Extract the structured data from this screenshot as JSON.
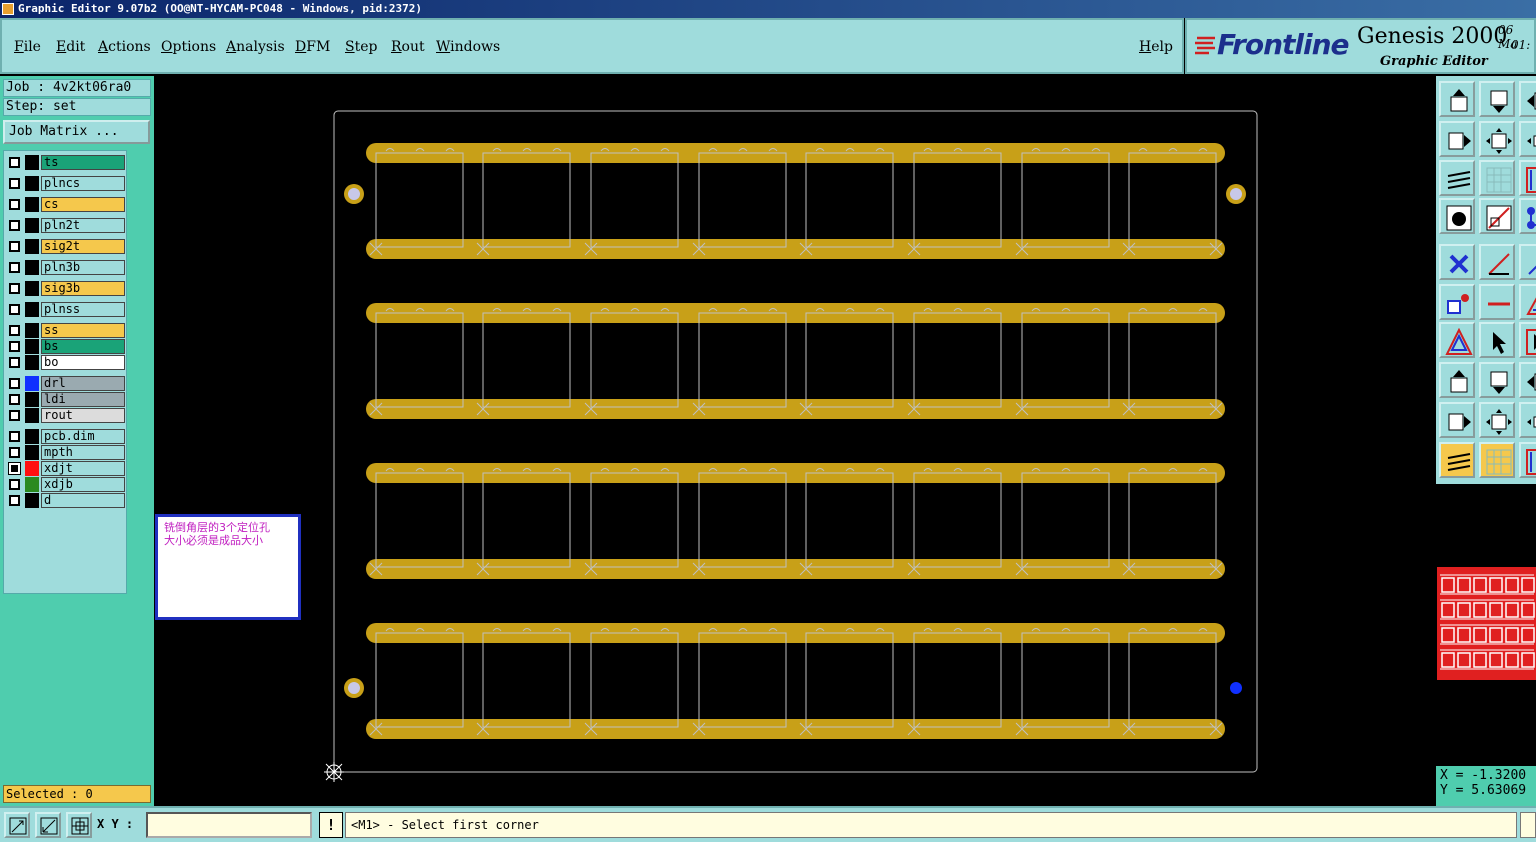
{
  "window": {
    "title": "Graphic Editor 9.07b2 (OO@NT-HYCAM-PC048 - Windows, pid:2372)"
  },
  "menu": {
    "file": "File",
    "edit": "Edit",
    "actions": "Actions",
    "options": "Options",
    "analysis": "Analysis",
    "dfm": "DFM",
    "step": "Step",
    "rout": "Rout",
    "windows": "Windows",
    "help": "Help"
  },
  "brand": {
    "logo": "Frontline",
    "product": "Genesis 2000",
    "subtitle": "Graphic Editor",
    "version_a": "06 Ma",
    "version_b": "01:"
  },
  "job": {
    "job_line": "Job : 4v2kt06ra0",
    "step_line": "Step: set",
    "matrix_button": "Job Matrix ..."
  },
  "layers": [
    {
      "name": "ts",
      "color": "#1aa378",
      "swatch": "#000000",
      "checked": false
    },
    {
      "name": "plncs",
      "color": "#9fdcdc",
      "swatch": "#000000",
      "checked": false
    },
    {
      "name": "cs",
      "color": "#f5c84c",
      "swatch": "#000000",
      "checked": false
    },
    {
      "name": "pln2t",
      "color": "#9fdcdc",
      "swatch": "#000000",
      "checked": false
    },
    {
      "name": "sig2t",
      "color": "#f5c84c",
      "swatch": "#000000",
      "checked": false
    },
    {
      "name": "pln3b",
      "color": "#9fdcdc",
      "swatch": "#000000",
      "checked": false
    },
    {
      "name": "sig3b",
      "color": "#f5c84c",
      "swatch": "#000000",
      "checked": false
    },
    {
      "name": "plnss",
      "color": "#9fdcdc",
      "swatch": "#000000",
      "checked": false
    },
    {
      "name": "ss",
      "color": "#f5c84c",
      "swatch": "#000000",
      "checked": false
    },
    {
      "name": "bs",
      "color": "#1aa378",
      "swatch": "#000000",
      "checked": false
    },
    {
      "name": "bo",
      "color": "#ffffff",
      "swatch": "#000000",
      "checked": false
    },
    {
      "name": "drl",
      "color": "#9aaab0",
      "swatch": "#1030ff",
      "checked": false
    },
    {
      "name": "ldi",
      "color": "#9aaab0",
      "swatch": "#000000",
      "checked": false
    },
    {
      "name": "rout",
      "color": "#dcdcdc",
      "swatch": "#000000",
      "checked": false
    },
    {
      "name": "pcb.dim",
      "color": "#9fdcdc",
      "swatch": "#000000",
      "checked": false
    },
    {
      "name": "mpth",
      "color": "#9fdcdc",
      "swatch": "#000000",
      "checked": false
    },
    {
      "name": "xdjt",
      "color": "#9fdcdc",
      "swatch": "#ff1010",
      "checked": true
    },
    {
      "name": "xdjb",
      "color": "#9fdcdc",
      "swatch": "#2a8a20",
      "checked": false
    },
    {
      "name": "d",
      "color": "#9fdcdc",
      "swatch": "#000000",
      "checked": false
    }
  ],
  "status": {
    "selected": "Selected : 0"
  },
  "note": {
    "line1": "铣倒角层的3个定位孔",
    "line2": "大小必须是成品大小"
  },
  "coords": {
    "x": "X = -1.3200",
    "y": "Y = 5.63069"
  },
  "bottom": {
    "xy_label": "X Y :",
    "xy_value": "",
    "warn": "!",
    "prompt": "<M1> - Select first corner"
  },
  "colors": {
    "panel": "#4fcdae",
    "menu": "#9fdcdc",
    "copper": "#c8a018",
    "outline": "#c0c0c0",
    "accent": "#f5c84c"
  },
  "icons": {
    "left_tools": [
      "window-zoom-icon",
      "zoom-fit-icon",
      "grid-snap-icon"
    ],
    "toolbox": [
      "pan-up-icon",
      "pan-down-icon",
      "pan-left-icon",
      "pan-right-icon",
      "zoom-home-icon",
      "zoom-center-icon",
      "layer-control-icon",
      "grid-icon",
      "snap-icon",
      "camera-icon",
      "measure-icon",
      "add-feature-icon",
      "delete-icon",
      "line-icon",
      "arc-icon",
      "pad-icon",
      "segment-icon",
      "triangle-up-icon",
      "triangle-double-icon",
      "select-pointer-icon",
      "select-box-pointer-icon"
    ]
  }
}
